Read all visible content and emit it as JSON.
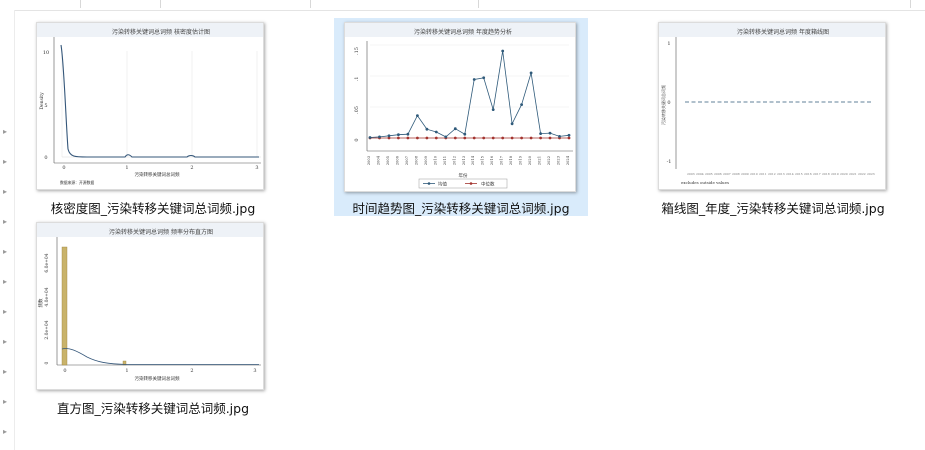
{
  "files": [
    {
      "name": "核密度图_污染转移关键词总词频.jpg",
      "chart": {
        "title": "污染转移关键词总词频 核密度估计图",
        "ylabel": "Density",
        "xlabel": "污染转移关键词总词频",
        "note": "数据来源：开源数据",
        "yticks": [
          "10",
          "5",
          "0"
        ],
        "xticks": [
          "0",
          "1",
          "2",
          "3"
        ]
      }
    },
    {
      "name": "时间趋势图_污染转移关键词总词频.jpg",
      "selected": true,
      "chart": {
        "title": "污染转移关键词总词频 年度趋势分析",
        "xlabel": "年份",
        "yticks": [
          ".15",
          ".1",
          ".05",
          "0"
        ],
        "years": [
          "2003",
          "2004",
          "2005",
          "2006",
          "2007",
          "2008",
          "2009",
          "2010",
          "2011",
          "2012",
          "2013",
          "2014",
          "2015",
          "2016",
          "2017",
          "2018",
          "2019",
          "2020",
          "2021",
          "2022",
          "2023",
          "2024"
        ],
        "series": [
          {
            "name": "均值",
            "color": "#2f5a7a",
            "values": [
              0.001,
              0.002,
              0.004,
              0.006,
              0.007,
              0.041,
              0.016,
              0.011,
              0.002,
              0.017,
              0.007,
              0.107,
              0.11,
              0.052,
              0.159,
              0.026,
              0.061,
              0.119,
              0.008,
              0.009,
              0.003,
              0.005
            ]
          },
          {
            "name": "中位数",
            "color": "#a3342f",
            "values": [
              0,
              0,
              0,
              0,
              0,
              0,
              0,
              0,
              0,
              0,
              0,
              0,
              0,
              0,
              0,
              0,
              0,
              0,
              0,
              0,
              0,
              0
            ]
          }
        ],
        "ylim": [
          0,
          0.17
        ]
      }
    },
    {
      "name": "箱线图_年度_污染转移关键词总词频.jpg",
      "chart": {
        "title": "污染转移关键词总词频 年度箱线图",
        "ylabel": "污染转移关键词总词频",
        "note": "excludes outside values",
        "yticks": [
          "1",
          "0",
          "-1"
        ]
      }
    },
    {
      "name": "直方图_污染转移关键词总词频.jpg",
      "chart": {
        "title": "污染转移关键词总词频 频率分布直方图",
        "ylabel": "频数",
        "xlabel": "污染转移关键词总词频",
        "yticks": [
          "6.0e+04",
          "4.0e+04",
          "2.0e+04",
          "0"
        ],
        "xticks": [
          "0",
          "1",
          "2",
          "3"
        ]
      }
    }
  ]
}
